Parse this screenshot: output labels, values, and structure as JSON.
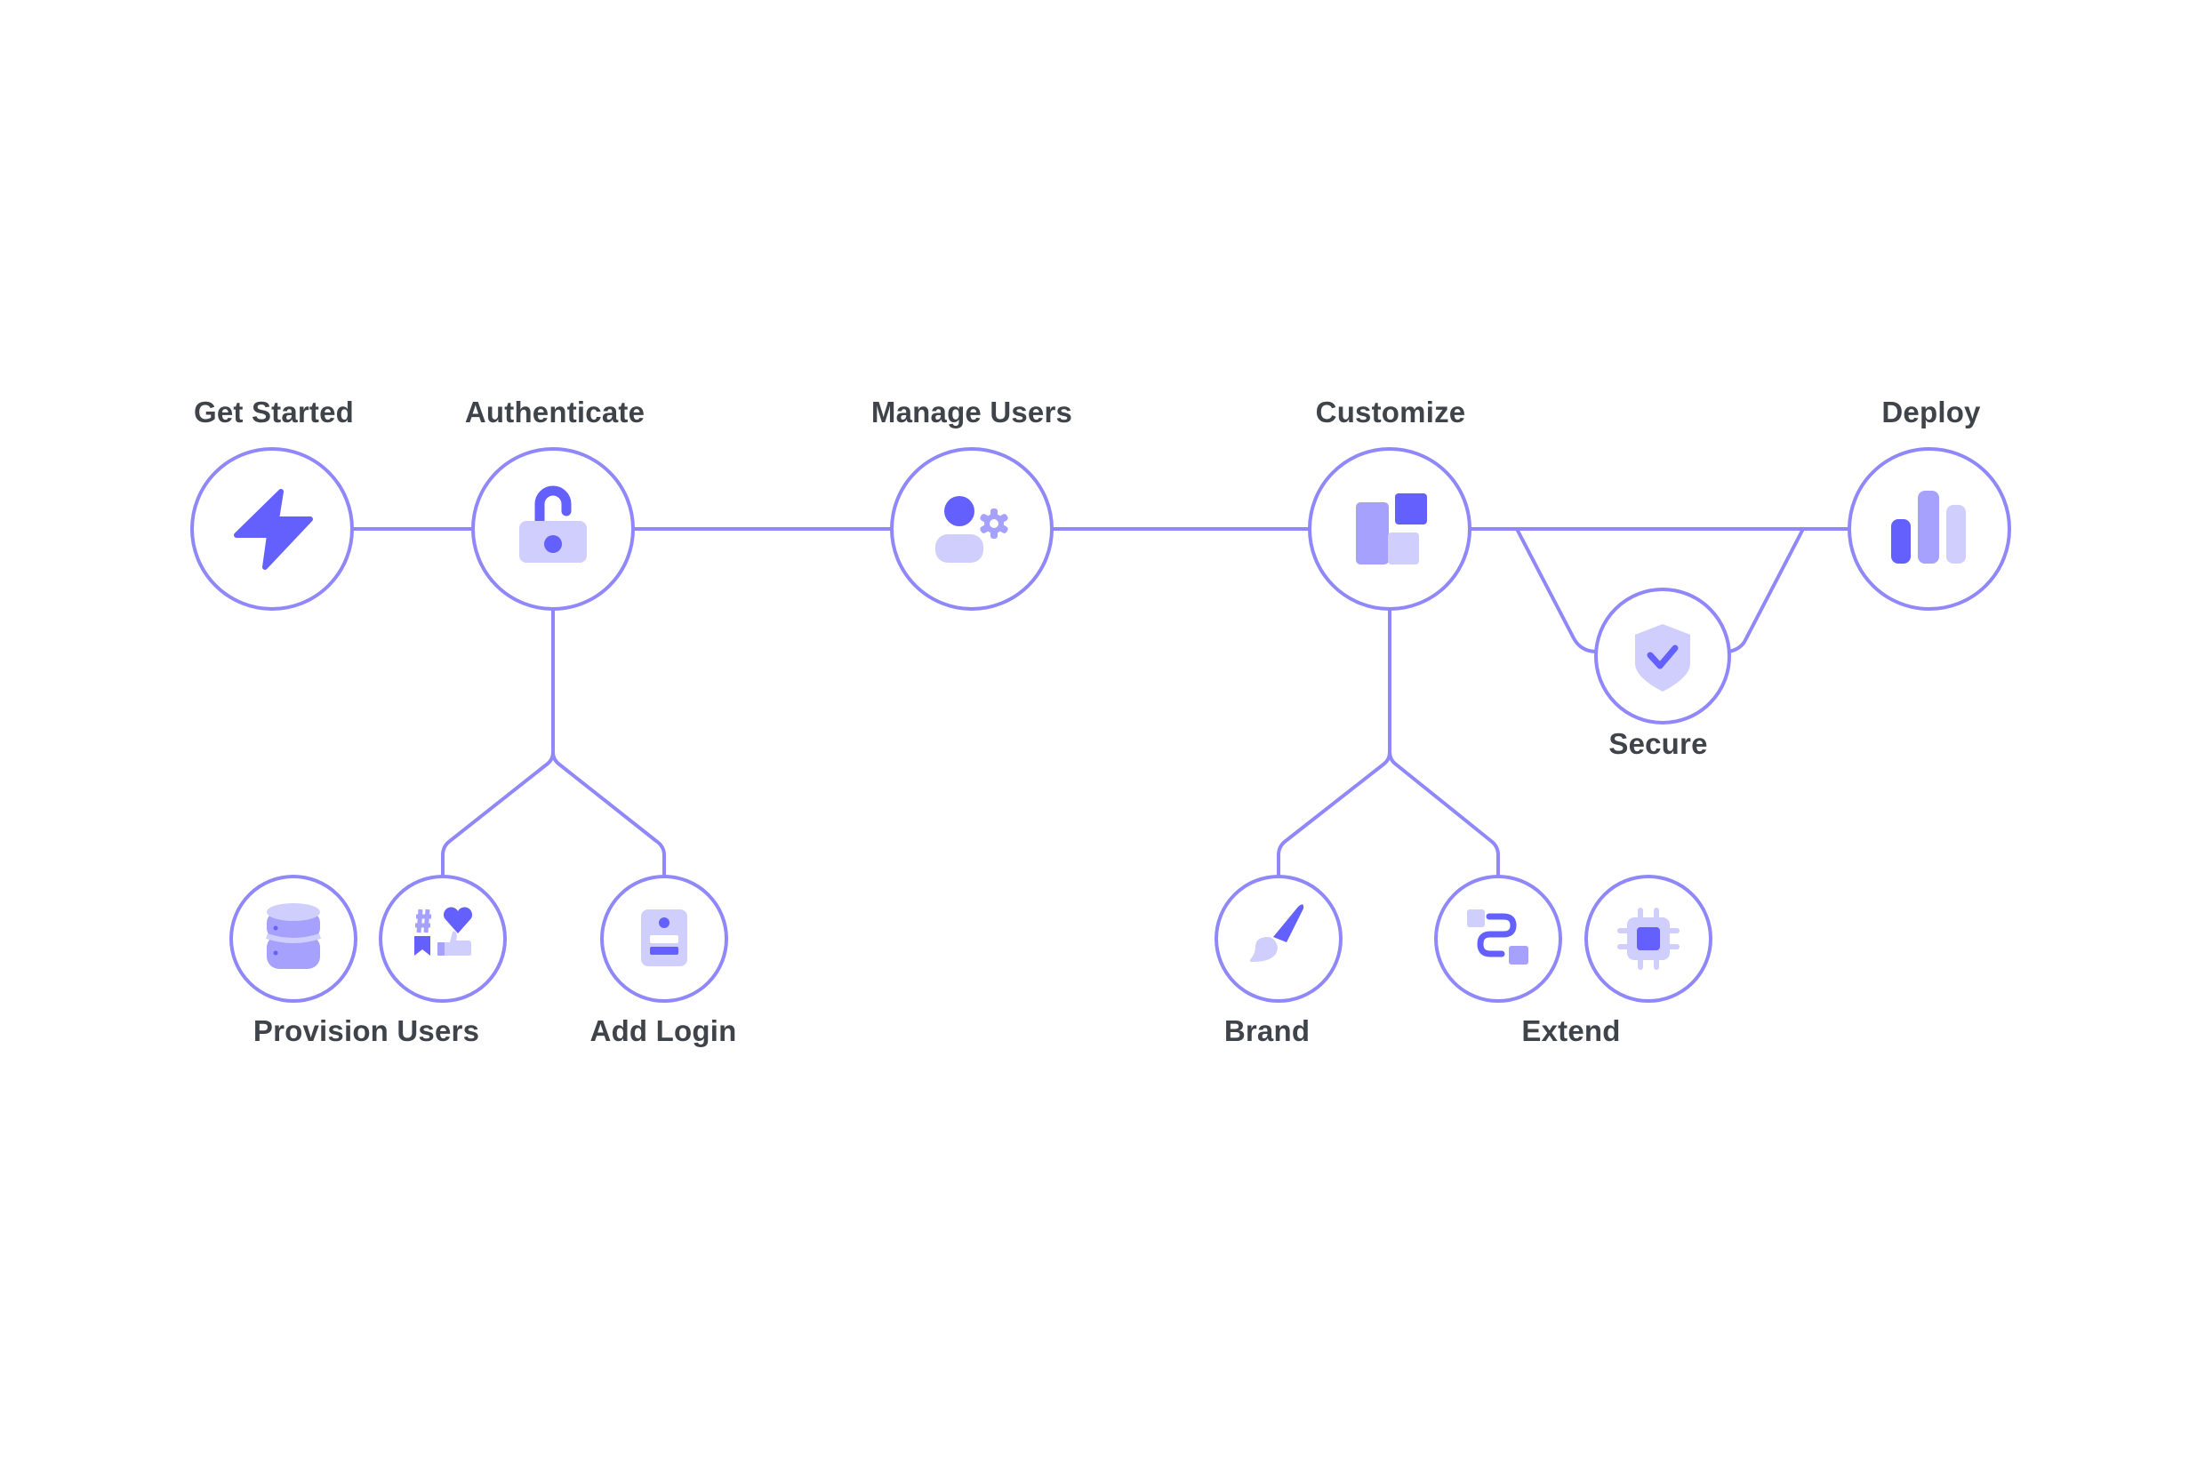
{
  "colors": {
    "line": "#8f87fa",
    "primary": "#6360fd",
    "medium": "#a5a1fc",
    "light": "#d0cefd",
    "text": "#3f434a",
    "background": "#ffffff"
  },
  "steps": [
    {
      "id": "get-started",
      "label": "Get Started",
      "icon": "lightning-bolt-icon"
    },
    {
      "id": "authenticate",
      "label": "Authenticate",
      "icon": "unlocked-padlock-icon"
    },
    {
      "id": "manage-users",
      "label": "Manage Users",
      "icon": "user-settings-icon"
    },
    {
      "id": "customize",
      "label": "Customize",
      "icon": "layout-blocks-icon"
    },
    {
      "id": "deploy",
      "label": "Deploy",
      "icon": "bar-chart-icon"
    }
  ],
  "branches": {
    "secure": {
      "label": "Secure",
      "icon": "shield-check-icon",
      "parent": "customize",
      "rejoins": "deploy"
    },
    "authenticate_children": [
      {
        "group": "provision-users",
        "label": "Provision Users",
        "icons": [
          "database-icon",
          "social-reactions-icon"
        ]
      },
      {
        "group": "add-login",
        "label": "Add Login",
        "icons": [
          "login-card-icon"
        ]
      }
    ],
    "customize_children": [
      {
        "group": "brand",
        "label": "Brand",
        "icons": [
          "paintbrush-icon"
        ]
      },
      {
        "group": "extend",
        "label": "Extend",
        "icons": [
          "integration-flow-icon",
          "chip-icon"
        ]
      }
    ]
  }
}
